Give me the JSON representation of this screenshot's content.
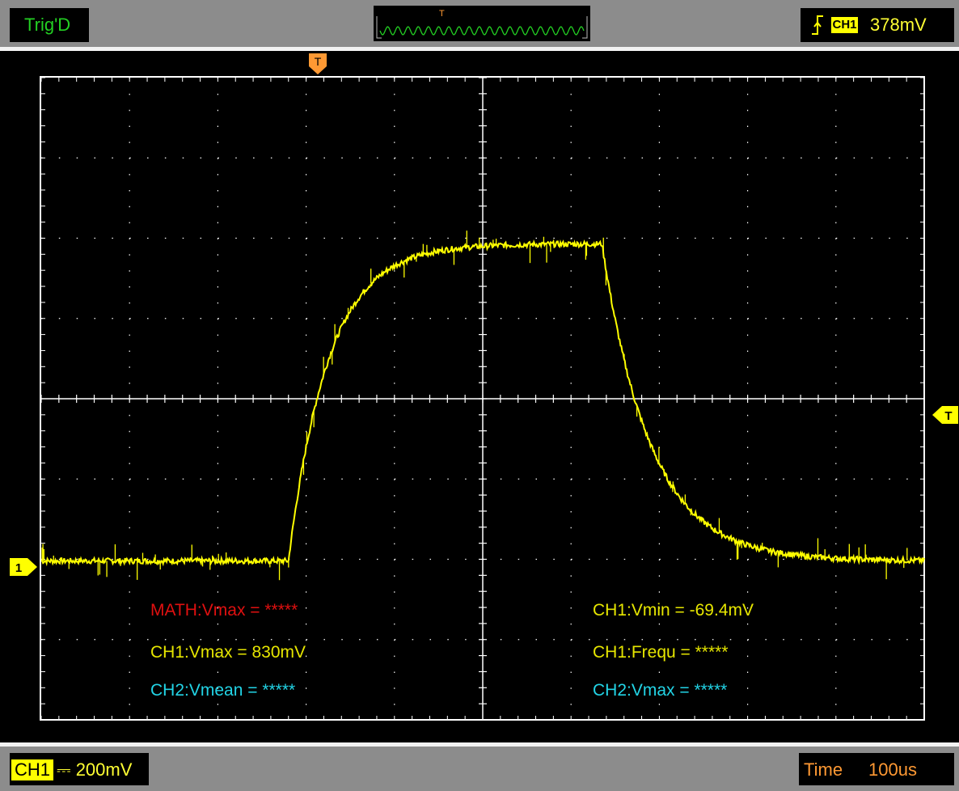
{
  "status": {
    "trigger_state": "Trig'D",
    "trigger_source": "CH1",
    "trigger_level": "378mV",
    "trigger_edge_icon": "rising-edge-icon"
  },
  "overview": {
    "marker_label": "T"
  },
  "markers": {
    "ch1_label": "1",
    "trigger_time_label": "T",
    "trigger_level_label": "T"
  },
  "measurements": {
    "left": [
      {
        "text": "MATH:Vmax = *****",
        "color": "#e01010"
      },
      {
        "text": "CH1:Vmax = 830mV",
        "color": "#e6e600"
      },
      {
        "text": "CH2:Vmean = *****",
        "color": "#22d4e6"
      }
    ],
    "right": [
      {
        "text": "CH1:Vmin = -69.4mV",
        "color": "#e6e600"
      },
      {
        "text": "CH1:Frequ = *****",
        "color": "#e6e600"
      },
      {
        "text": "CH2:Vmax = *****",
        "color": "#22d4e6"
      }
    ]
  },
  "bottom": {
    "channel_label": "CH1",
    "channel_coupling_symbol": "⎓",
    "channel_scale": "200mV",
    "time_label": "Time",
    "time_scale": "100us"
  },
  "colors": {
    "ch1": "#ffff00",
    "trigger_marker": "#ff9933",
    "status_green": "#23d023",
    "grid": "#ffffff"
  },
  "waveform": {
    "channel": "CH1",
    "volts_per_div": 0.2,
    "time_per_div_us": 100,
    "baseline_mV": 0,
    "plateau_mV": 790,
    "rise_start_div": 2.8,
    "fall_start_div": 6.35,
    "tau_rise_div": 0.45,
    "tau_fall_div": 0.55
  }
}
